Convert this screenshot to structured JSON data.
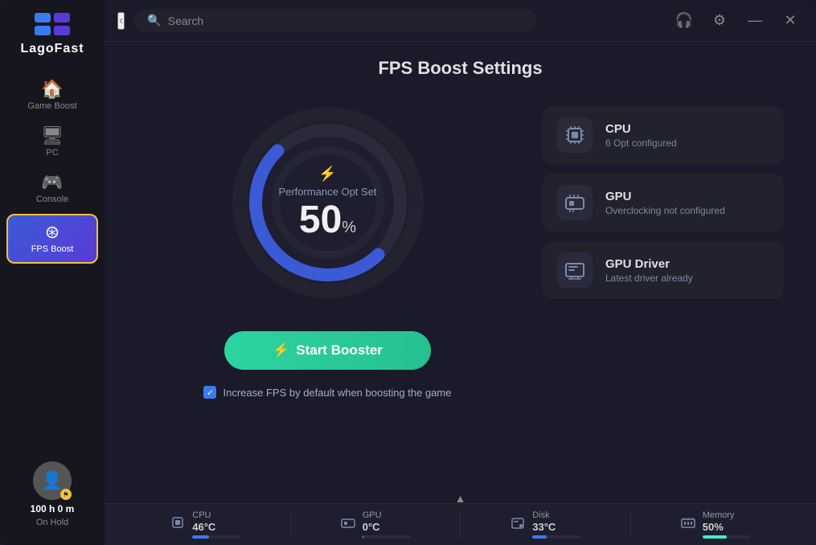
{
  "titlebar": {
    "search_placeholder": "Search",
    "back_label": "‹",
    "support_icon": "🎧",
    "settings_icon": "⚙",
    "minimize_icon": "—",
    "close_icon": "✕"
  },
  "logo": {
    "text": "LagoFast"
  },
  "nav": {
    "items": [
      {
        "id": "game-boost",
        "label": "Game Boost",
        "icon": "⌂"
      },
      {
        "id": "pc",
        "label": "PC",
        "icon": "🖥"
      },
      {
        "id": "console",
        "label": "Console",
        "icon": "🎮"
      },
      {
        "id": "fps-boost",
        "label": "FPS Boost",
        "icon": "⊛",
        "active": true
      }
    ]
  },
  "user": {
    "icon": "👤",
    "badge": "⚑",
    "time_label": "100 h 0 m",
    "status_label": "On Hold"
  },
  "page": {
    "title": "FPS Boost Settings"
  },
  "gauge": {
    "bolt_icon": "⚡",
    "label": "Performance Opt Set",
    "value": "50",
    "unit": "%",
    "arc_bg": "#2a2a3a",
    "arc_color": "#3a5ad6"
  },
  "start_button": {
    "icon": "⚡",
    "label": "Start Booster"
  },
  "checkbox": {
    "checked": true,
    "label": "Increase FPS by default when boosting the game"
  },
  "info_cards": [
    {
      "id": "cpu",
      "icon": "⬡",
      "title": "CPU",
      "subtitle": "6 Opt configured"
    },
    {
      "id": "gpu",
      "icon": "▣",
      "title": "GPU",
      "subtitle": "Overclocking not configured"
    },
    {
      "id": "gpu-driver",
      "icon": "🖥",
      "title": "GPU Driver",
      "subtitle": "Latest driver already"
    }
  ],
  "status_bar": {
    "items": [
      {
        "id": "cpu",
        "icon": "⬡",
        "label": "CPU",
        "value": "46°C",
        "fill_pct": 35,
        "fill_class": ""
      },
      {
        "id": "gpu",
        "icon": "▣",
        "label": "GPU",
        "value": "0°C",
        "fill_pct": 2,
        "fill_class": "gpu"
      },
      {
        "id": "disk",
        "icon": "💾",
        "label": "Disk",
        "value": "33°C",
        "fill_pct": 30,
        "fill_class": "disk"
      },
      {
        "id": "memory",
        "icon": "▦",
        "label": "Memory",
        "value": "50%",
        "fill_pct": 50,
        "fill_class": "mem"
      }
    ]
  }
}
